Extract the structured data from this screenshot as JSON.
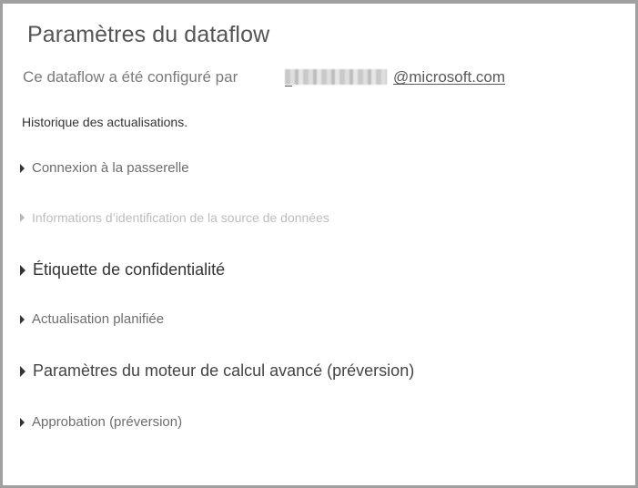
{
  "page": {
    "title": "Paramètres du dataflow",
    "configured_by_label": "Ce dataflow a été configuré par",
    "configured_by_email_domain": "@microsoft.com",
    "refresh_history_link": "Historique des actualisations."
  },
  "sections": [
    {
      "label": "Connexion à la passerelle"
    },
    {
      "label": "Informations d’identification de la source de données"
    },
    {
      "label": "Étiquette de confidentialité"
    },
    {
      "label": "Actualisation planifiée"
    },
    {
      "label": "Paramètres du moteur de calcul avancé (préversion)"
    },
    {
      "label": "Approbation (préversion)"
    }
  ],
  "icons": {
    "section_expander": "caret-right-icon",
    "redacted_user": "redacted-username"
  }
}
